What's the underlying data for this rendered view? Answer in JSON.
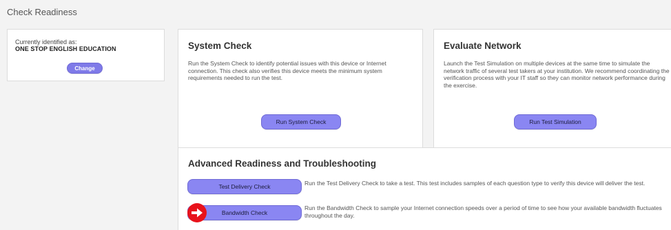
{
  "page": {
    "title": "Check Readiness"
  },
  "identity": {
    "label": "Currently identified as:",
    "name": "ONE STOP ENGLISH EDUCATION",
    "change_label": "Change"
  },
  "system_check": {
    "title": "System Check",
    "description": "Run the System Check to identify potential issues with this device or Internet connection. This check also verifies this device meets the minimum system requirements needed to run the test.",
    "button_label": "Run System Check"
  },
  "evaluate_network": {
    "title": "Evaluate Network",
    "description": "Launch the Test Simulation on multiple devices at the same time to simulate the network traffic of several test takers at your institution. We recommend coordinating the verification process with your IT staff so they can monitor network performance during the exercise.",
    "button_label": "Run Test Simulation"
  },
  "advanced": {
    "title": "Advanced Readiness and Troubleshooting",
    "items": [
      {
        "button_label": "Test Delivery Check",
        "description": "Run the Test Delivery Check to take a test. This test includes samples of each question type to verify this device will deliver the test."
      },
      {
        "button_label": "Bandwidth Check",
        "description": "Run the Bandwidth Check to sample your Internet connection speeds over a period of time to see how your available bandwidth fluctuates throughout the day."
      }
    ]
  },
  "annotation": {
    "icon": "arrow-right-icon",
    "color": "#e8121b"
  },
  "colors": {
    "button": "#8a86f2",
    "background": "#f3f3f3"
  }
}
